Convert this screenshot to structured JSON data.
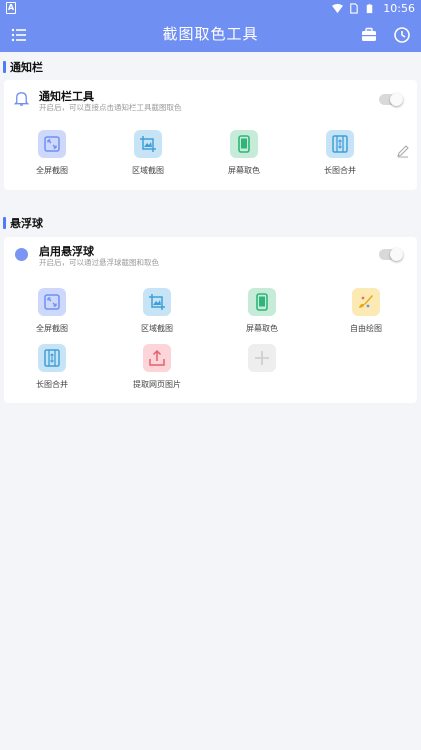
{
  "status_bar": {
    "time": "10:56"
  },
  "app_bar": {
    "title": "截图取色工具"
  },
  "notification_section": {
    "header": "通知栏",
    "toggle_title": "通知栏工具",
    "toggle_subtitle": "开启后，可以直接点击通知栏工具截图取色",
    "toggle_on": false,
    "tools": [
      {
        "label": "全屏截图",
        "icon": "fullscreen-icon",
        "color": "#cdd8fb"
      },
      {
        "label": "区域截图",
        "icon": "crop-image-icon",
        "color": "#c7e4f7"
      },
      {
        "label": "屏幕取色",
        "icon": "phone-icon",
        "color": "#c6ecd9"
      },
      {
        "label": "长图合并",
        "icon": "long-image-icon",
        "color": "#c7e4f7"
      }
    ]
  },
  "floating_section": {
    "header": "悬浮球",
    "toggle_title": "启用悬浮球",
    "toggle_subtitle": "开启后，可以通过悬浮球截图和取色",
    "toggle_on": false,
    "tools": [
      {
        "label": "全屏截图",
        "icon": "fullscreen-icon",
        "color": "#cdd8fb"
      },
      {
        "label": "区域截图",
        "icon": "crop-image-icon",
        "color": "#c7e4f7"
      },
      {
        "label": "屏幕取色",
        "icon": "phone-icon",
        "color": "#c6ecd9"
      },
      {
        "label": "自由绘图",
        "icon": "paint-icon",
        "color": "#fbeab4"
      },
      {
        "label": "长图合并",
        "icon": "long-image-icon",
        "color": "#c7e4f7"
      },
      {
        "label": "提取网页图片",
        "icon": "upload-icon",
        "color": "#fbd5d8"
      },
      {
        "label": "",
        "icon": "plus-icon",
        "color": "#eeeeee"
      }
    ]
  }
}
